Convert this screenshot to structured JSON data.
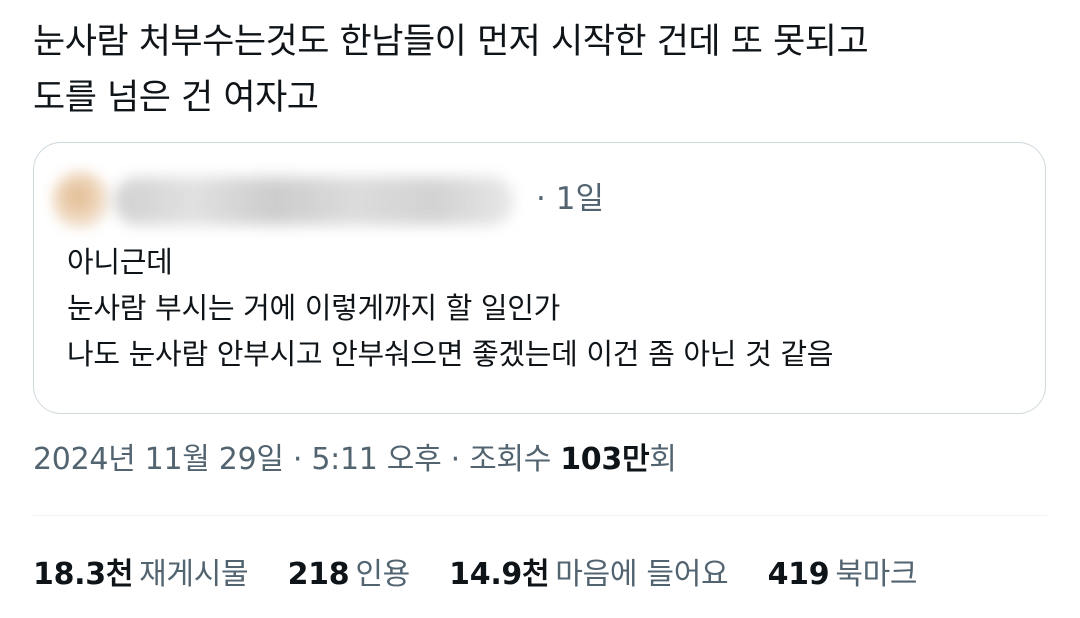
{
  "tweet": {
    "text_line1": "눈사람 처부수는것도 한남들이 먼저 시작한 건데 또 못되고",
    "text_line2": "도를 넘은 건 여자고"
  },
  "quoted_tweet": {
    "time_separator": "·",
    "time": "1일",
    "lines": [
      "아니근데",
      "눈사람 부시는 거에 이렇게까지 할 일인가",
      "나도 눈사람 안부시고 안부숴으면 좋겠는데 이건 좀 아닌 것 같음"
    ]
  },
  "timestamp": {
    "datetime": "2024년 11월 29일 · 5:11 오후 · ",
    "views_label": "조회수 ",
    "views_number": "103만",
    "views_suffix": "회"
  },
  "stats": {
    "retweets": {
      "count": "18.3천",
      "label": "재게시물"
    },
    "quotes": {
      "count": "218",
      "label": "인용"
    },
    "likes": {
      "count": "14.9천",
      "label": "마음에 들어요"
    },
    "bookmarks": {
      "count": "419",
      "label": "북마크"
    }
  },
  "colors": {
    "text_primary": "#0f1419",
    "text_secondary": "#536471",
    "border": "#cfd9de"
  }
}
